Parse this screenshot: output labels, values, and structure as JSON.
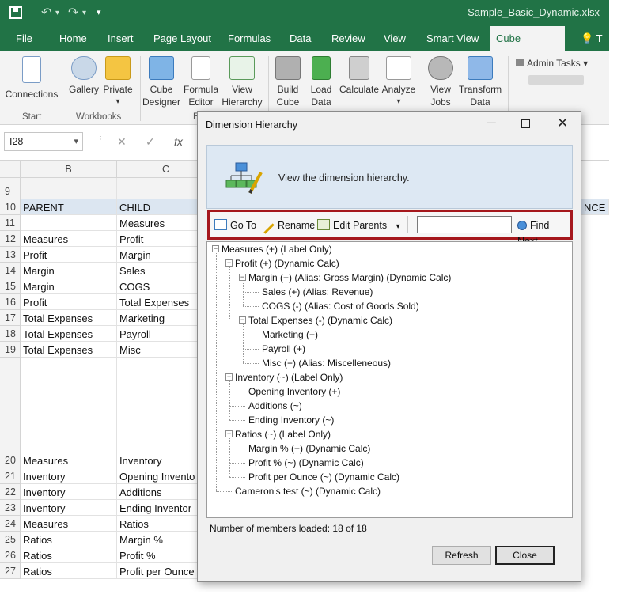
{
  "window": {
    "filename": "Sample_Basic_Dynamic.xlsx"
  },
  "ribbon_tabs": [
    "File",
    "Home",
    "Insert",
    "Page Layout",
    "Formulas",
    "Data",
    "Review",
    "View",
    "Smart View",
    "Cube Designer",
    "T"
  ],
  "ribbon": {
    "connections": "Connections",
    "gallery": "Gallery",
    "private": "Private",
    "cube_designer": [
      "Cube",
      "Designer"
    ],
    "formula_editor": [
      "Formula",
      "Editor"
    ],
    "view_hierarchy": [
      "View",
      "Hierarchy"
    ],
    "build_cube": [
      "Build",
      "Cube"
    ],
    "load_data": [
      "Load",
      "Data"
    ],
    "calculate": "Calculate",
    "analyze": "Analyze",
    "view_jobs": [
      "View",
      "Jobs"
    ],
    "transform_data": [
      "Transform",
      "Data"
    ],
    "admin_tasks": "Admin Tasks",
    "group_start": "Start",
    "group_workbooks": "Workbooks",
    "group_e": "E"
  },
  "formula_bar": {
    "name_box": "I28"
  },
  "sheet": {
    "columns": [
      "B",
      "C"
    ],
    "rows": [
      {
        "num": "9",
        "parent": "",
        "child": ""
      },
      {
        "num": "10",
        "parent": "PARENT",
        "child": "CHILD"
      },
      {
        "num": "11",
        "parent": "",
        "child": "Measures"
      },
      {
        "num": "12",
        "parent": "Measures",
        "child": "Profit"
      },
      {
        "num": "13",
        "parent": "Profit",
        "child": "Margin"
      },
      {
        "num": "14",
        "parent": "Margin",
        "child": "Sales"
      },
      {
        "num": "15",
        "parent": "Margin",
        "child": "COGS"
      },
      {
        "num": "16",
        "parent": "Profit",
        "child": "Total Expenses"
      },
      {
        "num": "17",
        "parent": "Total Expenses",
        "child": "Marketing"
      },
      {
        "num": "18",
        "parent": "Total Expenses",
        "child": "Payroll"
      },
      {
        "num": "19",
        "parent": "Total Expenses",
        "child": "Misc"
      },
      {
        "num": "20",
        "parent": "Measures",
        "child": "Inventory"
      },
      {
        "num": "21",
        "parent": "Inventory",
        "child": "Opening Invento"
      },
      {
        "num": "22",
        "parent": "Inventory",
        "child": "Additions"
      },
      {
        "num": "23",
        "parent": "Inventory",
        "child": "Ending Inventor"
      },
      {
        "num": "24",
        "parent": "Measures",
        "child": "Ratios"
      },
      {
        "num": "25",
        "parent": "Ratios",
        "child": "Margin %"
      },
      {
        "num": "26",
        "parent": "Ratios",
        "child": "Profit %"
      },
      {
        "num": "27",
        "parent": "Ratios",
        "child": "Profit per Ounce"
      }
    ],
    "partial_header": "NCE"
  },
  "dialog": {
    "title": "Dimension Hierarchy",
    "banner_text": "View the dimension hierarchy.",
    "toolbar": {
      "goto": "Go To",
      "rename": "Rename",
      "edit_parents": "Edit Parents",
      "find_value": "",
      "find_next": "Find Next"
    },
    "tree": [
      {
        "label": "Measures (+) (Label Only)",
        "level": 0,
        "expander": "−"
      },
      {
        "label": "Profit (+) (Dynamic Calc)",
        "level": 1,
        "expander": "−"
      },
      {
        "label": "Margin (+) (Alias: Gross Margin) (Dynamic Calc)",
        "level": 2,
        "expander": "−"
      },
      {
        "label": "Sales (+) (Alias: Revenue)",
        "level": 3,
        "expander": ""
      },
      {
        "label": "COGS (-) (Alias: Cost of Goods Sold)",
        "level": 3,
        "expander": ""
      },
      {
        "label": "Total Expenses (-) (Dynamic Calc)",
        "level": 2,
        "expander": "−"
      },
      {
        "label": "Marketing (+)",
        "level": 3,
        "expander": ""
      },
      {
        "label": "Payroll (+)",
        "level": 3,
        "expander": ""
      },
      {
        "label": "Misc (+) (Alias: Miscelleneous)",
        "level": 3,
        "expander": ""
      },
      {
        "label": "Inventory (~) (Label Only)",
        "level": 1,
        "expander": "−"
      },
      {
        "label": "Opening Inventory (+)",
        "level": 2,
        "expander": ""
      },
      {
        "label": "Additions (~)",
        "level": 2,
        "expander": ""
      },
      {
        "label": "Ending Inventory (~)",
        "level": 2,
        "expander": ""
      },
      {
        "label": "Ratios (~) (Label Only)",
        "level": 1,
        "expander": "−"
      },
      {
        "label": "Margin % (+) (Dynamic Calc)",
        "level": 2,
        "expander": ""
      },
      {
        "label": "Profit % (~) (Dynamic Calc)",
        "level": 2,
        "expander": ""
      },
      {
        "label": "Profit per Ounce (~) (Dynamic Calc)",
        "level": 2,
        "expander": ""
      },
      {
        "label": "Cameron's test (~) (Dynamic Calc)",
        "level": 1,
        "expander": ""
      }
    ],
    "status": "Number of members loaded:  18 of 18",
    "refresh": "Refresh",
    "close": "Close"
  },
  "colors": {
    "excel_green": "#217346",
    "highlight_border": "#a5171c",
    "banner": "#dde8f3"
  }
}
